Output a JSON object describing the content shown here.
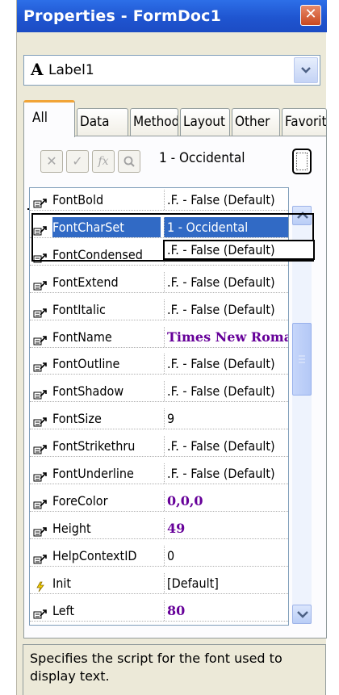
{
  "window": {
    "title": "Properties - FormDoc1",
    "close_label": "✕"
  },
  "object_selector": {
    "icon": "A",
    "value": "Label1"
  },
  "tabs": [
    {
      "label": "All",
      "active": true
    },
    {
      "label": "Data"
    },
    {
      "label": "Methods"
    },
    {
      "label": "Layout"
    },
    {
      "label": "Other"
    },
    {
      "label": "Favorites"
    }
  ],
  "toolbar": {
    "cancel_icon": "✕",
    "accept_icon": "✓",
    "function_icon": "fx",
    "zoom_icon": "zoom-icon",
    "current_value": "1 - Occidental"
  },
  "properties": [
    {
      "name": "FontBold",
      "value": ".F. - False (Default)"
    },
    {
      "name": "FontCharSet",
      "value": "1 - Occidental",
      "selected": true
    },
    {
      "name": "FontCondensed",
      "value": ".F. - False (Default)"
    },
    {
      "name": "FontExtend",
      "value": ".F. - False (Default)"
    },
    {
      "name": "FontItalic",
      "value": ".F. - False (Default)"
    },
    {
      "name": "FontName",
      "value": "Times New Roman",
      "bold": true
    },
    {
      "name": "FontOutline",
      "value": ".F. - False (Default)"
    },
    {
      "name": "FontShadow",
      "value": ".F. - False (Default)"
    },
    {
      "name": "FontSize",
      "value": "9"
    },
    {
      "name": "FontStrikethru",
      "value": ".F. - False (Default)"
    },
    {
      "name": "FontUnderline",
      "value": ".F. - False (Default)"
    },
    {
      "name": "ForeColor",
      "value": "0,0,0",
      "bold": true
    },
    {
      "name": "Height",
      "value": "49",
      "bold": true
    },
    {
      "name": "HelpContextID",
      "value": "0"
    },
    {
      "name": "Init",
      "value": "[Default]",
      "event": true
    },
    {
      "name": "Left",
      "value": "80",
      "bold": true
    }
  ],
  "tooltip": ".F. - False (Default)",
  "description": "Specifies the script for the font used to display text.",
  "colors": {
    "title_bar": "#1f55d0",
    "selection": "#316ac5",
    "modified_value": "#660099",
    "active_tab_accent": "#f1a437"
  }
}
